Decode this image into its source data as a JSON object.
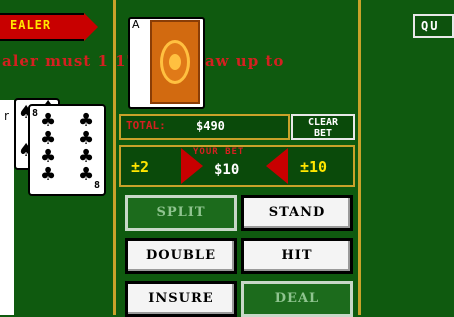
{
  "dealer": {
    "tag_label": "EALER",
    "card_rank": "A"
  },
  "quit": {
    "label": "QU"
  },
  "rule_text": "aler must         1 17 and draw up to",
  "edge_fragment": "r",
  "player": {
    "card_rank": "8",
    "card_rank_bottom": "8",
    "back_card_suit": "♠"
  },
  "total": {
    "label": "TOTAL:",
    "value": "$490"
  },
  "clear_bet": {
    "line1": "CLEAR",
    "line2": "BET"
  },
  "bet": {
    "label": "YOUR BET",
    "value": "$10",
    "decrease_label": "±2",
    "increase_label": "±10"
  },
  "actions": {
    "split": "SPLIT",
    "stand": "STAND",
    "double": "DOUBLE",
    "hit": "HIT",
    "insure": "INSURE",
    "deal": "DEAL"
  },
  "colors": {
    "felt": "#0f5a0f",
    "tag_red": "#c80000",
    "gold": "#c9a22a",
    "text_red": "#d42020",
    "yellow": "#ffe600"
  }
}
